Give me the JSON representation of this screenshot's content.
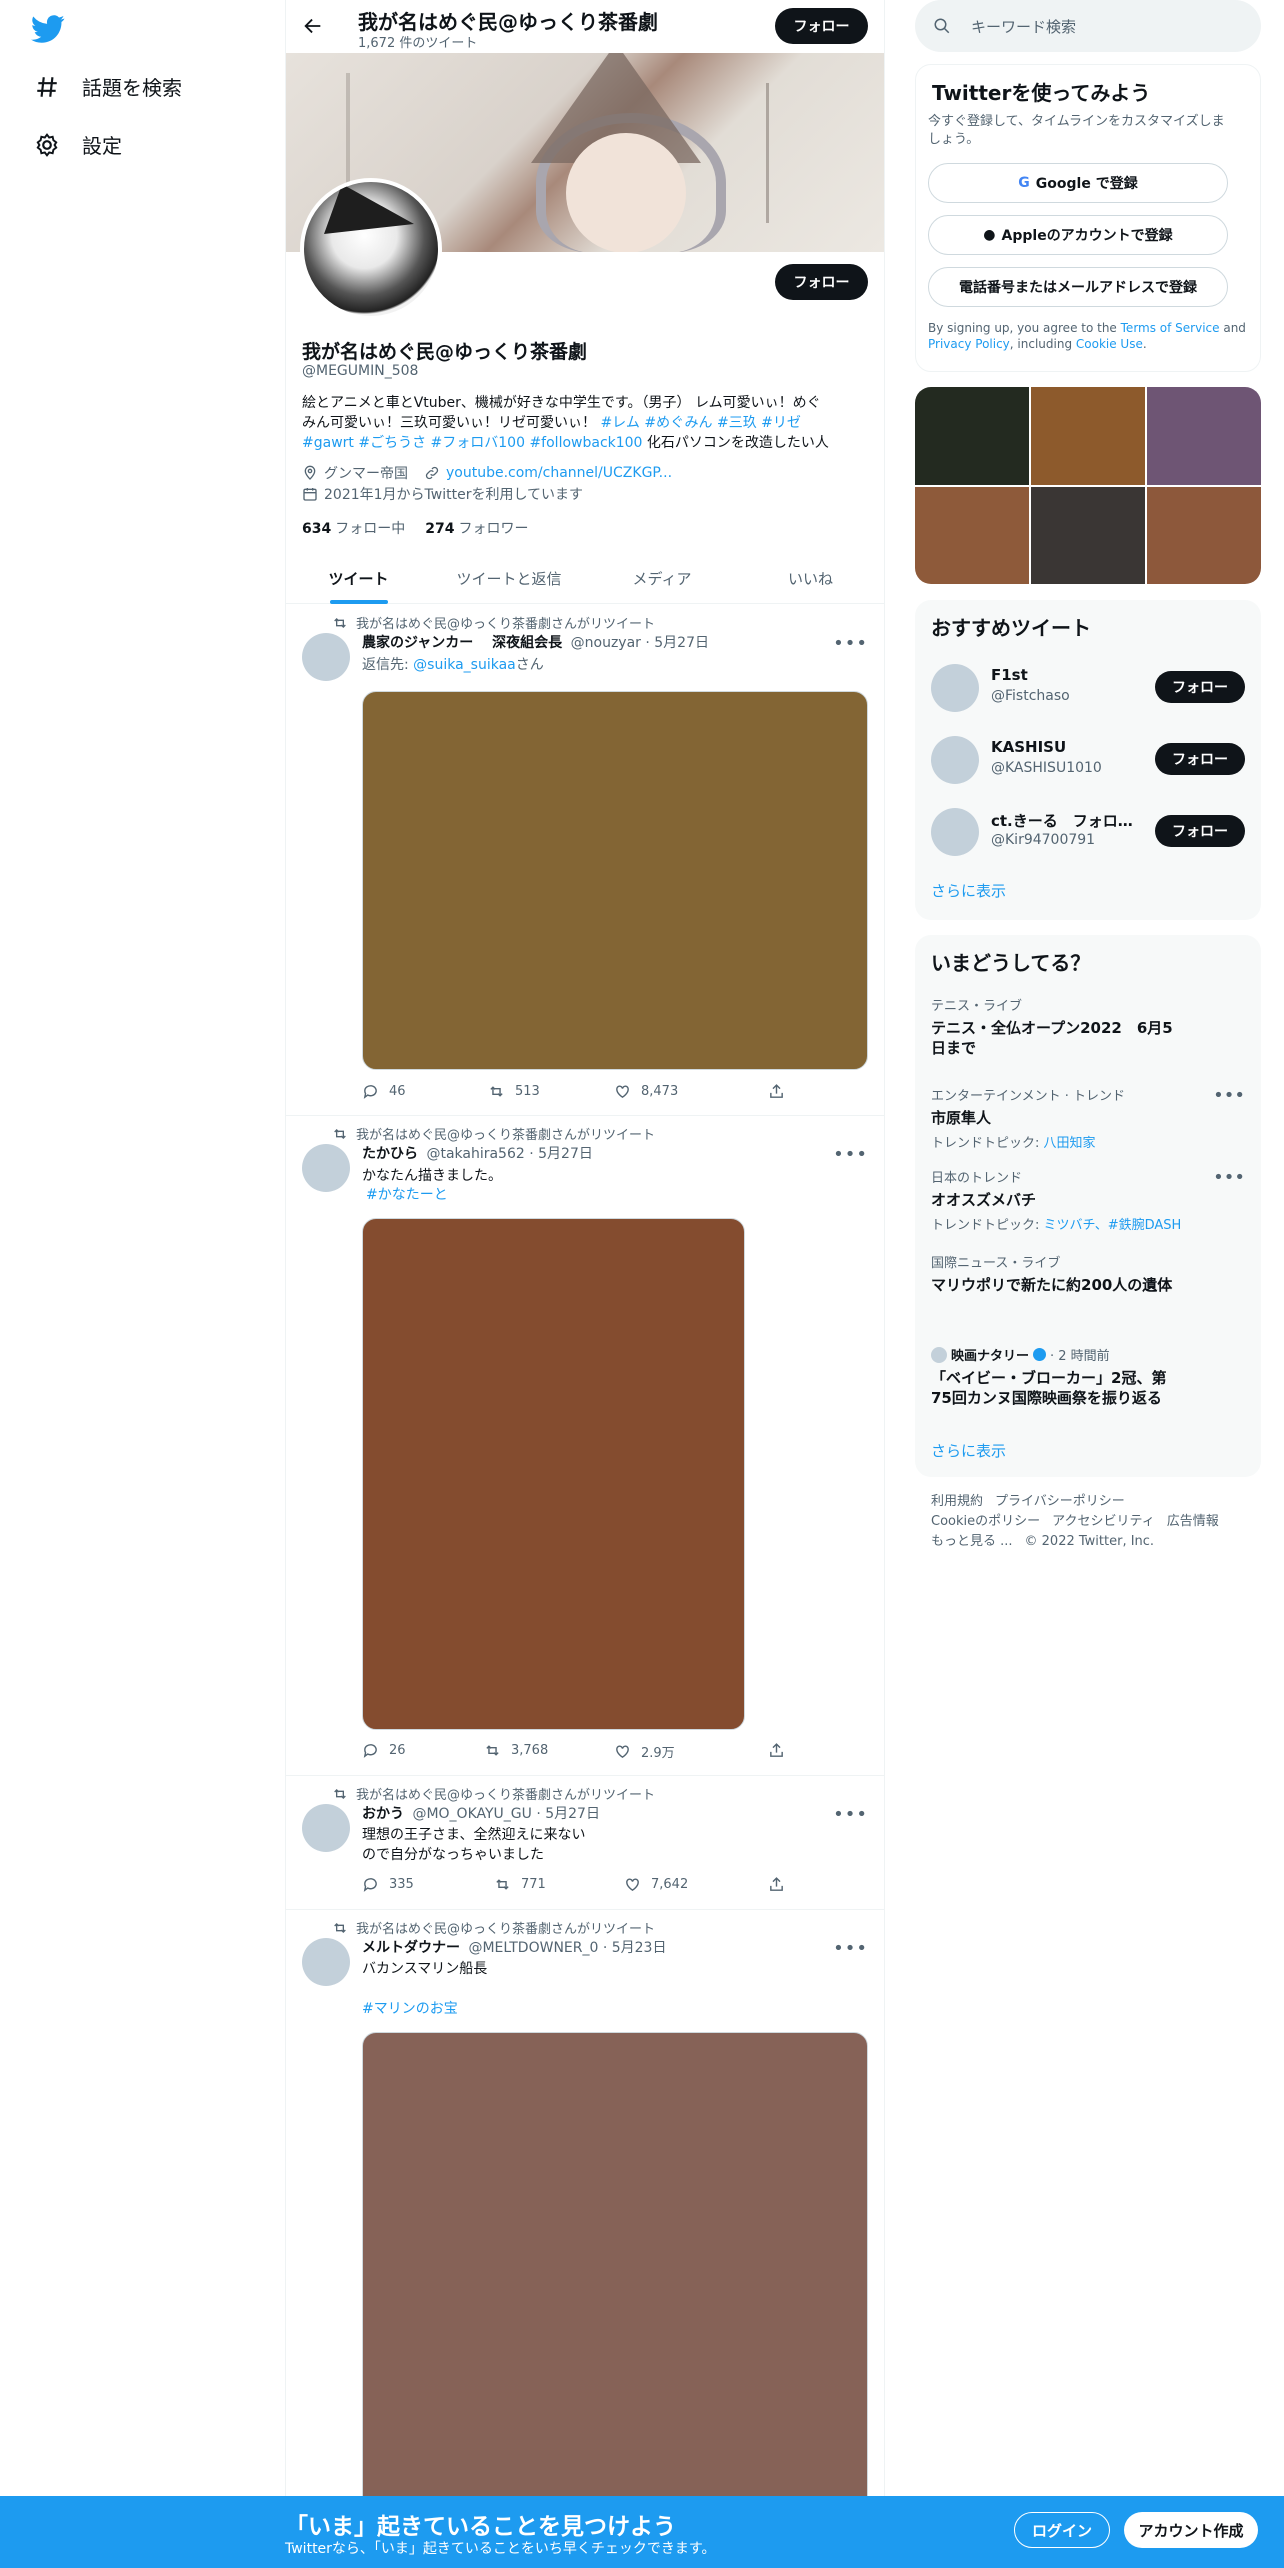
{
  "nav": {
    "explore_label": "話題を検索",
    "settings_label": "設定"
  },
  "header": {
    "title": "我が名はめぐ民@ゆっくり茶番劇",
    "tweet_count": "1,672 件のツイート",
    "follow_label": "フォロー"
  },
  "profile": {
    "name": "我が名はめぐ民@ゆっくり茶番劇",
    "handle": "@MEGUMIN_508",
    "follow_label": "フォロー",
    "bio_line1": "絵とアニメと車とVtuber、機械が好きな中学生です。（男子） レム可愛いぃ！めぐ",
    "bio_line2": "みん可愛いぃ！三玖可愛いぃ！リゼ可愛いぃ！",
    "bio_tags1": [
      " #レム",
      " #めぐみん",
      " #三玖",
      " #リゼ"
    ],
    "bio_tags2": [
      "#gawrt",
      "#ごちうさ",
      "#フォロバ100",
      "#followback100"
    ],
    "bio_tail": "化石パソコンを改造したい人",
    "location": "グンマー帝国",
    "url": "youtube.com/channel/UCZKGP...",
    "joined": "2021年1月からTwitterを利用しています",
    "following_count": "634",
    "following_label": "フォロー中",
    "followers_count": "274",
    "followers_label": "フォロワー"
  },
  "tabs": [
    "ツイート",
    "ツイートと返信",
    "メディア",
    "いいね"
  ],
  "tweets": [
    {
      "retweeted_by": "我が名はめぐ民@ゆっくり茶番劇さんがリツイート",
      "name": "農家のジャンカー　 深夜組会長",
      "meta": "@nouzyar · 5月27日",
      "reply_prefix": "返信先: ",
      "reply_to": "@suika_suikaa",
      "reply_suffix": "さん",
      "media_color": "#836534",
      "replies": "46",
      "retweets": "513",
      "likes": "8,473"
    },
    {
      "retweeted_by": "我が名はめぐ民@ゆっくり茶番劇さんがリツイート",
      "name": "たかひら",
      "meta": "@takahira562 · 5月27日",
      "text": "かなたん描きました。",
      "tag": "#かなたーと",
      "media_color": "#844c2f",
      "replies": "26",
      "retweets": "3,768",
      "likes": "2.9万"
    },
    {
      "retweeted_by": "我が名はめぐ民@ゆっくり茶番劇さんがリツイート",
      "name": "おかう",
      "meta": "@MO_OKAYU_GU · 5月27日",
      "text1": "理想の王子さま、全然迎えに来ない",
      "text2": "ので自分がなっちゃいました",
      "replies": "335",
      "retweets": "771",
      "likes": "7,642"
    },
    {
      "retweeted_by": "我が名はめぐ民@ゆっくり茶番劇さんがリツイート",
      "name": "メルトダウナー",
      "meta": "@MELTDOWNER_0 · 5月23日",
      "text": "バカンスマリン船長",
      "tag": "#マリンのお宝",
      "media_color": "#866257"
    }
  ],
  "search": {
    "placeholder": "キーワード検索"
  },
  "signup": {
    "title": "Twitterを使ってみよう",
    "desc1": "今すぐ登録して、タイムラインをカスタマイズしま",
    "desc2": "しょう。",
    "google": "Google で登録",
    "apple": "Appleのアカウントで登録",
    "phone": "電話番号またはメールアドレスで登録",
    "terms_1": "By signing up, you agree to the ",
    "terms_link1": "Terms of Service",
    "terms_2": " and",
    "terms_link2": "Privacy Policy",
    "terms_3": ", including ",
    "terms_link3": "Cookie Use",
    "terms_4": "."
  },
  "media_grid_colors": [
    "#232a20",
    "#8d5a2c",
    "#6e5574",
    "#8e5a3a",
    "#3a3634",
    "#8d583b"
  ],
  "recommend": {
    "title": "おすすめツイート",
    "users": [
      {
        "name": "F1st",
        "handle": "@Fistchaso",
        "follow": "フォロー"
      },
      {
        "name": "KASHISU",
        "handle": "@KASHISU1010",
        "follow": "フォロー"
      },
      {
        "name": "ct.きーる　フォロバ100",
        "handle": "@Kir94700791",
        "follow": "フォロー"
      }
    ],
    "show_more": "さらに表示"
  },
  "trends": {
    "title": "いまどうしてる？",
    "items": [
      {
        "cat": "テニス・ライブ",
        "title1": "テニス・全仏オープン2022　6月5",
        "title2": "日まで"
      },
      {
        "cat": "エンターテインメント · トレンド",
        "title": "市原隼人",
        "sub_prefix": "トレンドトピック: ",
        "sub_link": "八田知家"
      },
      {
        "cat": "日本のトレンド",
        "title": "オオスズメバチ",
        "sub_prefix": "トレンドトピック: ",
        "sub_link": "ミツバチ、#鉄腕DASH"
      },
      {
        "cat": "国際ニュース・ライブ",
        "title": "マリウポリで新たに約200人の遺体"
      },
      {
        "source": "映画ナタリー",
        "time": " · 2 時間前",
        "title1": "「ベイビー・ブローカー」2冠、第",
        "title2": "75回カンヌ国際映画祭を振り返る"
      }
    ],
    "show_more": "さらに表示"
  },
  "footer": {
    "line1": [
      "利用規約",
      "プライバシーポリシー"
    ],
    "line2": [
      "Cookieのポリシー",
      "アクセシビリティ",
      "広告情報"
    ],
    "more": "もっと見る ...",
    "copyright": "© 2022 Twitter, Inc."
  },
  "bottom_bar": {
    "title": "「いま」起きていることを見つけよう",
    "subtitle": "Twitterなら、「いま」起きていることをいち早くチェックできます。",
    "login": "ログイン",
    "signup": "アカウント作成"
  },
  "colors": {
    "accent": "#1d9bf0",
    "text": "#0f1419",
    "muted": "#536471"
  }
}
